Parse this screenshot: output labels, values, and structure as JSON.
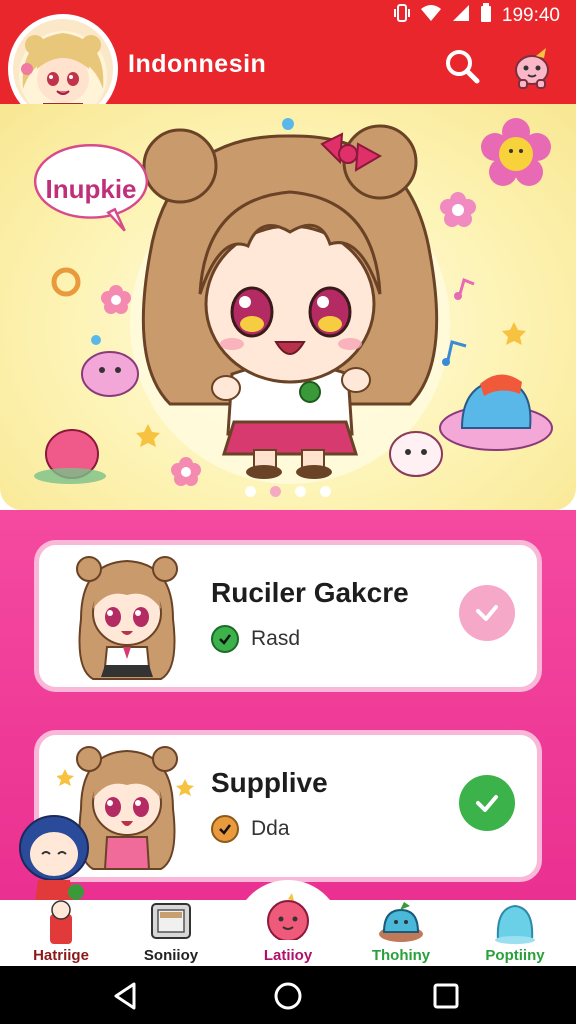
{
  "status_bar": {
    "time": "199:40",
    "icons": [
      "vibrate-icon",
      "wifi-icon",
      "signal-icon",
      "battery-icon"
    ]
  },
  "app_bar": {
    "title": "Indonnesin",
    "icons": [
      "search-icon",
      "profile-mascot-icon"
    ]
  },
  "hero": {
    "speech_bubble": "Inupkie",
    "page_count": 4,
    "active_page": 1
  },
  "cards": [
    {
      "title": "Ruciler Gakcre",
      "status": "Rasd",
      "status_color": "#3bb34a",
      "action": "heart-check-icon",
      "action_color": "#f6a8c8"
    },
    {
      "title": "Supplive",
      "status": "Dda",
      "status_color": "#e89a3c",
      "action": "check-icon",
      "action_color": "#3bb34a"
    }
  ],
  "bottom_nav": {
    "items": [
      {
        "label": "Hatriige",
        "icon": "character-icon",
        "color": "#8a1a1a"
      },
      {
        "label": "Soniioy",
        "icon": "monitor-icon",
        "color": "#222222"
      },
      {
        "label": "Latiioy",
        "icon": "strawberry-icon",
        "color": "#b0106a"
      },
      {
        "label": "Thohiny",
        "icon": "cake-icon",
        "color": "#2aa03a"
      },
      {
        "label": "Poptiiny",
        "icon": "jelly-icon",
        "color": "#2aa03a"
      }
    ]
  },
  "colors": {
    "primary": "#e8262c",
    "accent": "#ea2f90"
  }
}
